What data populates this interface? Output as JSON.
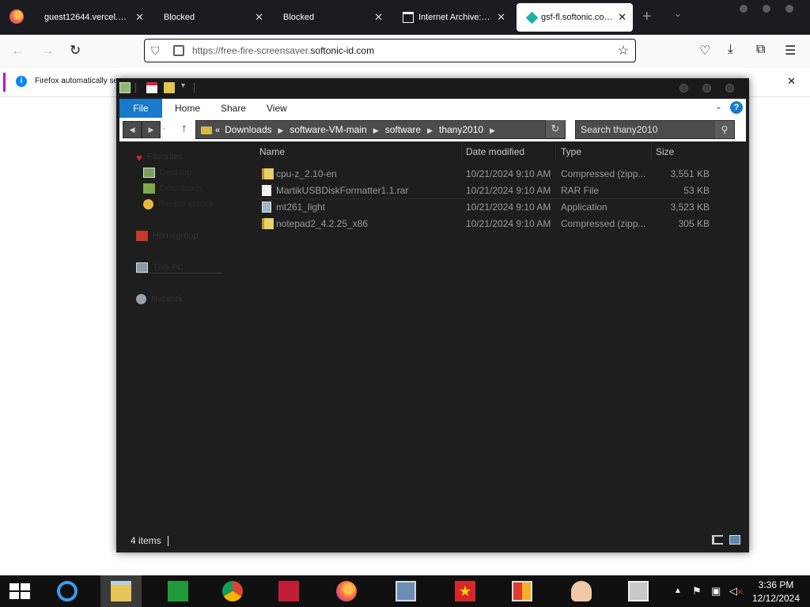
{
  "browser": {
    "tabs": [
      {
        "label": "guest12644.vercel.app"
      },
      {
        "label": "Blocked"
      },
      {
        "label": "Blocked"
      },
      {
        "label": "Internet Archive: Di"
      },
      {
        "label": "gsf-fl.softonic.com/3"
      }
    ],
    "new_tab": "+",
    "url_prefix": "https://free-fire-screensaver.",
    "url_domain": "softonic-id.com",
    "notification": "Firefox automatically se"
  },
  "explorer": {
    "ribbon_tabs": [
      "File",
      "Home",
      "Share",
      "View"
    ],
    "breadcrumb_prefix": "«",
    "breadcrumb": [
      "Downloads",
      "software-VM-main",
      "software",
      "thany2010"
    ],
    "search_placeholder": "Search thany2010",
    "nav_pane": {
      "favorites": "Favorites",
      "desktop": "Desktop",
      "downloads": "Downloads",
      "recent": "Recent places",
      "homegroup": "Homegroup",
      "thispc": "This PC",
      "network": "Network"
    },
    "columns": {
      "name": "Name",
      "date": "Date modified",
      "type": "Type",
      "size": "Size"
    },
    "files": [
      {
        "name": "cpu-z_2.10-en",
        "date": "10/21/2024 9:10 AM",
        "type": "Compressed (zipp...",
        "size": "3,551 KB",
        "icon": "zip-folder-icon"
      },
      {
        "name": "MartikUSBDiskFormatter1.1.rar",
        "date": "10/21/2024 9:10 AM",
        "type": "RAR File",
        "size": "53 KB",
        "icon": "file-icon"
      },
      {
        "name": "mt261_light",
        "date": "10/21/2024 9:10 AM",
        "type": "Application",
        "size": "3,523 KB",
        "icon": "application-icon"
      },
      {
        "name": "notepad2_4.2.25_x86",
        "date": "10/21/2024 9:10 AM",
        "type": "Compressed (zipp...",
        "size": "305 KB",
        "icon": "zip-folder-icon"
      }
    ],
    "status": "4 items"
  },
  "taskbar": {
    "time": "3:36 PM",
    "date": "12/12/2024"
  }
}
